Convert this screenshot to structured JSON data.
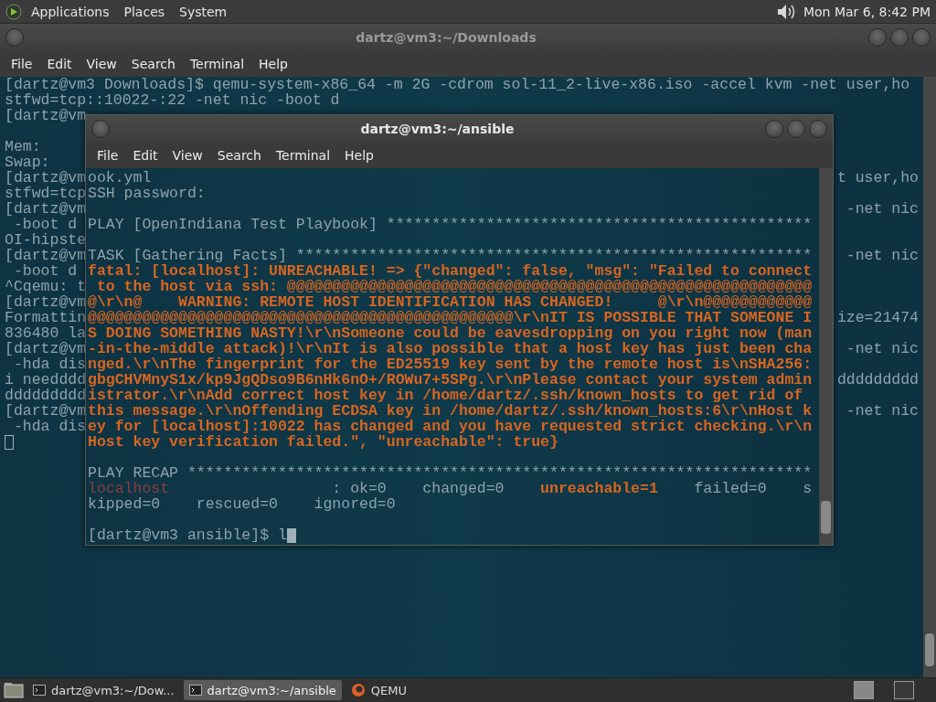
{
  "top_panel": {
    "menus": [
      "Applications",
      "Places",
      "System"
    ],
    "clock": "Mon Mar 6, 8:42 PM"
  },
  "back_window": {
    "title": "dartz@vm3:~/Downloads",
    "menu": [
      "File",
      "Edit",
      "View",
      "Search",
      "Terminal",
      "Help"
    ],
    "lines": [
      {
        "kind": "text",
        "left": "[dartz@vm3 Downloads]$ qemu-system-x86_64 -m 2G -cdrom sol-11_2-live-x86.iso -accel kvm -net user,ho"
      },
      {
        "kind": "text",
        "left": "stfwd=tcp::10022-:22 -net nic -boot d"
      },
      {
        "kind": "text",
        "left": "[dartz@vm"
      },
      {
        "kind": "blank"
      },
      {
        "kind": "text",
        "left": "Mem:"
      },
      {
        "kind": "text",
        "left": "Swap:"
      },
      {
        "kind": "text",
        "left": "[dartz@vm",
        "right": "t user,ho"
      },
      {
        "kind": "text",
        "left": "stfwd=tcp"
      },
      {
        "kind": "text",
        "left": "[dartz@vm",
        "right": "-net nic"
      },
      {
        "kind": "text",
        "left": " -boot d"
      },
      {
        "kind": "text",
        "left": "OI-hipste"
      },
      {
        "kind": "text",
        "left": "[dartz@vm",
        "right": "-net nic"
      },
      {
        "kind": "text",
        "left": " -boot d"
      },
      {
        "kind": "text",
        "left": "^Cqemu: t"
      },
      {
        "kind": "text",
        "left": "[dartz@vm"
      },
      {
        "kind": "text",
        "left": "Formattin",
        "right": "ize=21474"
      },
      {
        "kind": "text",
        "left": "836480 la"
      },
      {
        "kind": "text",
        "left": "[dartz@vm",
        "right": "-net nic"
      },
      {
        "kind": "text",
        "left": " -hda dis"
      },
      {
        "kind": "text",
        "left": "i needddd",
        "right": "ddddddddd"
      },
      {
        "kind": "text",
        "left": "ddddddddd"
      },
      {
        "kind": "text",
        "left": "[dartz@vm",
        "right": "-net nic"
      },
      {
        "kind": "text",
        "left": " -hda dis"
      }
    ]
  },
  "front_window": {
    "title": "dartz@vm3:~/ansible",
    "menu": [
      "File",
      "Edit",
      "View",
      "Search",
      "Terminal",
      "Help"
    ],
    "lines": [
      {
        "kind": "text",
        "segments": [
          {
            "text": "ook.yml",
            "kind": "plain"
          }
        ]
      },
      {
        "kind": "text",
        "segments": [
          {
            "text": "SSH password:",
            "kind": "plain"
          }
        ]
      },
      {
        "kind": "blank"
      },
      {
        "kind": "text",
        "segments": [
          {
            "text": "PLAY [OpenIndiana Test Playbook] ***********************************************",
            "kind": "plain"
          }
        ]
      },
      {
        "kind": "blank"
      },
      {
        "kind": "text",
        "segments": [
          {
            "text": "TASK [Gathering Facts] *********************************************************",
            "kind": "plain"
          }
        ]
      },
      {
        "kind": "text",
        "segments": [
          {
            "text": "fatal: [localhost]: UNREACHABLE! => {\"changed\": false, \"msg\": \"Failed to connect",
            "kind": "error"
          }
        ]
      },
      {
        "kind": "text",
        "segments": [
          {
            "text": " to the host via ssh: @@@@@@@@@@@@@@@@@@@@@@@@@@@@@@@@@@@@@@@@@@@@@@@@@@@@@@@@@@",
            "kind": "error"
          }
        ]
      },
      {
        "kind": "text",
        "segments": [
          {
            "text": "@\\r\\n@    WARNING: REMOTE HOST IDENTIFICATION HAS CHANGED!     @\\r\\n@@@@@@@@@@@@",
            "kind": "error"
          }
        ]
      },
      {
        "kind": "text",
        "segments": [
          {
            "text": "@@@@@@@@@@@@@@@@@@@@@@@@@@@@@@@@@@@@@@@@@@@@@@@\\r\\nIT IS POSSIBLE THAT SOMEONE I",
            "kind": "error"
          }
        ]
      },
      {
        "kind": "text",
        "segments": [
          {
            "text": "S DOING SOMETHING NASTY!\\r\\nSomeone could be eavesdropping on you right now (man",
            "kind": "error"
          }
        ]
      },
      {
        "kind": "text",
        "segments": [
          {
            "text": "-in-the-middle attack)!\\r\\nIt is also possible that a host key has just been cha",
            "kind": "error"
          }
        ]
      },
      {
        "kind": "text",
        "segments": [
          {
            "text": "nged.\\r\\nThe fingerprint for the ED25519 key sent by the remote host is\\nSHA256:",
            "kind": "error"
          }
        ]
      },
      {
        "kind": "text",
        "segments": [
          {
            "text": "gbgCHVMnyS1x/kp9JgQDso9B6nHk6nO+/ROWu7+5SPg.\\r\\nPlease contact your system admin",
            "kind": "error"
          }
        ]
      },
      {
        "kind": "text",
        "segments": [
          {
            "text": "istrator.\\r\\nAdd correct host key in /home/dartz/.ssh/known_hosts to get rid of",
            "kind": "error"
          }
        ]
      },
      {
        "kind": "text",
        "segments": [
          {
            "text": "this message.\\r\\nOffending ECDSA key in /home/dartz/.ssh/known_hosts:6\\r\\nHost k",
            "kind": "error"
          }
        ]
      },
      {
        "kind": "text",
        "segments": [
          {
            "text": "ey for [localhost]:10022 has changed and you have requested strict checking.\\r\\n",
            "kind": "error"
          }
        ]
      },
      {
        "kind": "text",
        "segments": [
          {
            "text": "Host key verification failed.\", \"unreachable\": true}",
            "kind": "error"
          }
        ]
      },
      {
        "kind": "blank"
      },
      {
        "kind": "text",
        "segments": [
          {
            "text": "PLAY RECAP *********************************************************************",
            "kind": "plain"
          }
        ]
      },
      {
        "kind": "text",
        "segments": [
          {
            "text": "localhost",
            "kind": "failed_host"
          },
          {
            "text": "                  : ok=0    changed=0    ",
            "kind": "plain"
          },
          {
            "text": "unreachable=1",
            "kind": "error"
          },
          {
            "text": "    failed=0    s",
            "kind": "plain"
          }
        ]
      },
      {
        "kind": "text",
        "segments": [
          {
            "text": "kipped=0    rescued=0    ignored=0",
            "kind": "plain"
          }
        ]
      },
      {
        "kind": "blank"
      },
      {
        "kind": "prompt",
        "segments": [
          {
            "text": "[dartz@vm3 ansible]$ l",
            "kind": "plain"
          }
        ]
      }
    ]
  },
  "taskbar": {
    "tasks": [
      {
        "kind": "terminal",
        "label": "dartz@vm3:~/Dow...",
        "selected": false
      },
      {
        "kind": "terminal",
        "label": "dartz@vm3:~/ansible",
        "selected": true
      },
      {
        "kind": "qemu",
        "label": "QEMU",
        "selected": false
      }
    ]
  }
}
